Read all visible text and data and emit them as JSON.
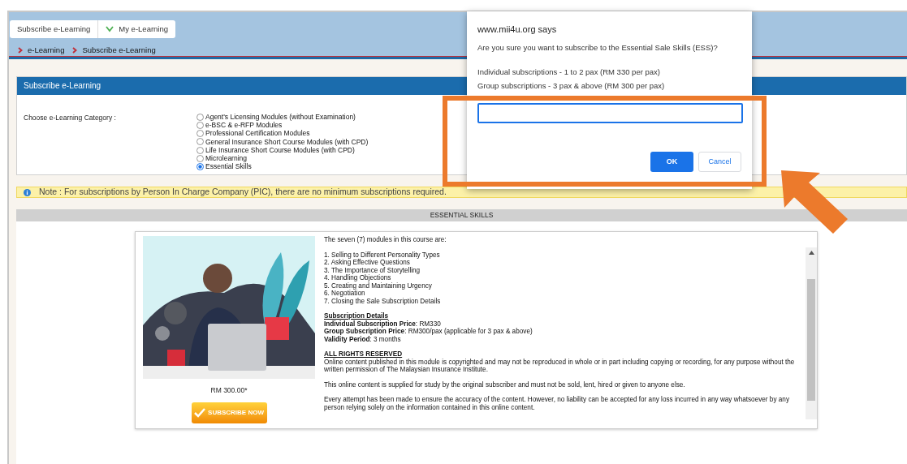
{
  "top_nav": [
    "Subscribe e-Learning",
    "My e-Learning"
  ],
  "breadcrumb": [
    "e-Learning",
    "Subscribe e-Learning"
  ],
  "panel": {
    "title": "Subscribe e-Learning",
    "category_label": "Choose e-Learning Category :",
    "options": [
      {
        "label": "Agent's Licensing Modules (without Examination)",
        "selected": false
      },
      {
        "label": "e-BSC & e-RFP Modules",
        "selected": false
      },
      {
        "label": "Professional Certification Modules",
        "selected": false
      },
      {
        "label": "General Insurance Short Course Modules (with CPD)",
        "selected": false
      },
      {
        "label": "Life Insurance Short Course Modules (with CPD)",
        "selected": false
      },
      {
        "label": "Microlearning",
        "selected": false
      },
      {
        "label": "Essential Skills",
        "selected": true
      }
    ]
  },
  "note": "Note : For subscriptions by Person In Charge Company (PIC), there are no minimum subscriptions required.",
  "section_title": "ESSENTIAL SKILLS",
  "course": {
    "price": "RM 300.00*",
    "subscribe_button": "SUBSCRIBE NOW",
    "intro": "The seven (7) modules in this course are:",
    "modules": [
      "1. Selling to Different Personality Types",
      "2. Asking Effective Questions",
      "3. The Importance of Storytelling",
      "4. Handling Objections",
      "5. Creating and Maintaining Urgency",
      "6. Negotiation",
      "7. Closing the Sale Subscription Details"
    ],
    "details_heading": "Subscription Details",
    "details": [
      "**Individual Subscription Price**: RM330",
      "**Group Subscription Price**: RM300/pax (applicable for 3 pax & above)",
      "**Validity Period**: 3 months"
    ],
    "rights_heading": "ALL RIGHTS RESERVED",
    "paragraphs": [
      "Online content published in this module is copyrighted and may not be reproduced in whole or in part including copying or recording, for any purpose without the written permission of The Malaysian Insurance Institute.",
      "This online content is supplied for study by the original subscriber and must not be sold, lent, hired or given to anyone else.",
      "Every attempt has been made to ensure the accuracy of the content. However, no liability can be accepted for any loss incurred in any way whatsoever by any person relying solely on the information contained in this online content."
    ]
  },
  "dialog": {
    "origin": "www.mii4u.org says",
    "question": "Are you sure you want to subscribe to the Essential Sale Skills (ESS)?",
    "lines": [
      "Individual subscriptions - 1 to 2 pax (RM 330 per pax)",
      "Group subscriptions - 3 pax & above (RM 300 per pax)"
    ],
    "ok": "OK",
    "cancel": "Cancel"
  }
}
